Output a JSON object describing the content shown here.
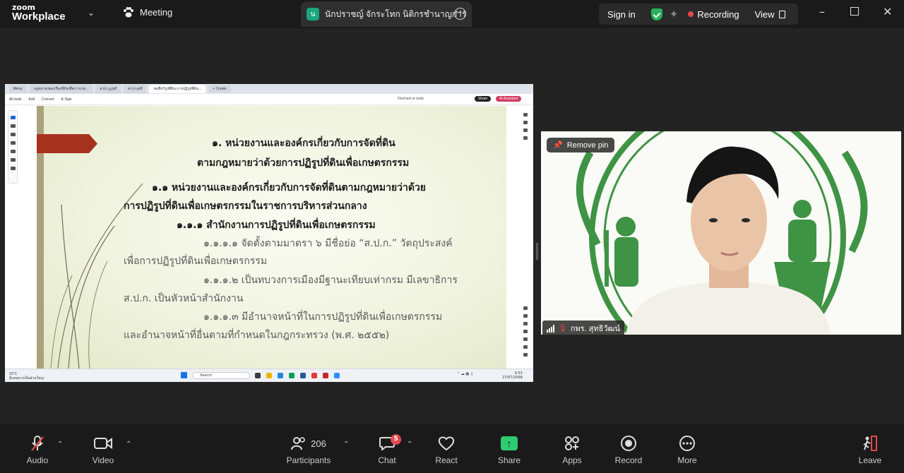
{
  "app": {
    "brand_line1": "zoom",
    "brand_line2": "Workplace",
    "meeting_label": "Meeting"
  },
  "tab": {
    "badge": "น",
    "title": "นักปราชญ์ จักระโทก นิติกรชำนาญการ"
  },
  "header": {
    "sign_in": "Sign in",
    "recording": "Recording",
    "view": "View",
    "recording_color": "#e5484d",
    "shield_color": "#27b35b"
  },
  "shared": {
    "browser_tabs": [
      "Menu",
      "กฎหมายเพลงเรื่องที่ดินเพื่อการเกษ...",
      "ส.ปก.ฏ.pdf",
      "ส.ป.ก.pdf",
      "ขอชื่อวิรูปที่ดิน.การปฏิรูปที่ดิน...",
      "+ Create"
    ],
    "pdf_menu": [
      "All tools",
      "Edit",
      "Convert",
      "E-Sign"
    ],
    "find": "Find text or tools",
    "share_btn": "Share",
    "ai_btn": "AI Assistant",
    "slide_lines": [
      "๑. หน่วยงานและองค์กรเกี่ยวกับการจัดที่ดิน",
      "ตามกฎหมายว่าด้วยการปฏิรูปที่ดินเพื่อเกษตรกรรม",
      "๑.๑ หน่วยงานและองค์กรเกี่ยวกับการจัดที่ดินตามกฎหมายว่าด้วย",
      "การปฏิรูปที่ดินเพื่อเกษตรกรรมในราชการบริหารส่วนกลาง",
      "๑.๑.๑ สำนักงานการปฏิรูปที่ดินเพื่อเกษตรกรรม",
      "๑.๑.๑.๑ จัดตั้งตามมาตรา ๖ มีชื่อย่อ “ส.ป.ก.” วัตถุประสงค์",
      "เพื่อการปฏิรูปที่ดินเพื่อเกษตรกรรม",
      "๑.๑.๑.๒ เป็นทบวงการเมืองมีฐานะเทียบเท่ากรม มีเลขาธิการ",
      "ส.ป.ก. เป็นหัวหน้าสำนักงาน",
      "๑.๑.๑.๓ มีอำนาจหน้าที่ในการปฏิรูปที่ดินเพื่อเกษตรกรรม",
      "และอำนาจหน้าที่อื่นตามที่กำหนดในกฎกระทรวง (พ.ศ. ๒๕๕๒)"
    ],
    "taskbar": {
      "weather_temp": "31°C",
      "weather_text": "มีเมฆมากเป็นส่วนใหญ่",
      "search": "Search",
      "time": "9:53",
      "date": "27/07/2568"
    }
  },
  "video": {
    "remove_pin": "Remove pin",
    "participant_name": "กพร. สุทธิวัฒน์"
  },
  "toolbar": {
    "audio": "Audio",
    "video": "Video",
    "participants": "Participants",
    "participants_count": "206",
    "chat": "Chat",
    "chat_badge": "5",
    "react": "React",
    "share": "Share",
    "apps": "Apps",
    "record": "Record",
    "more": "More",
    "leave": "Leave",
    "share_color": "#2ecc71",
    "alert_color": "#e5484d"
  }
}
